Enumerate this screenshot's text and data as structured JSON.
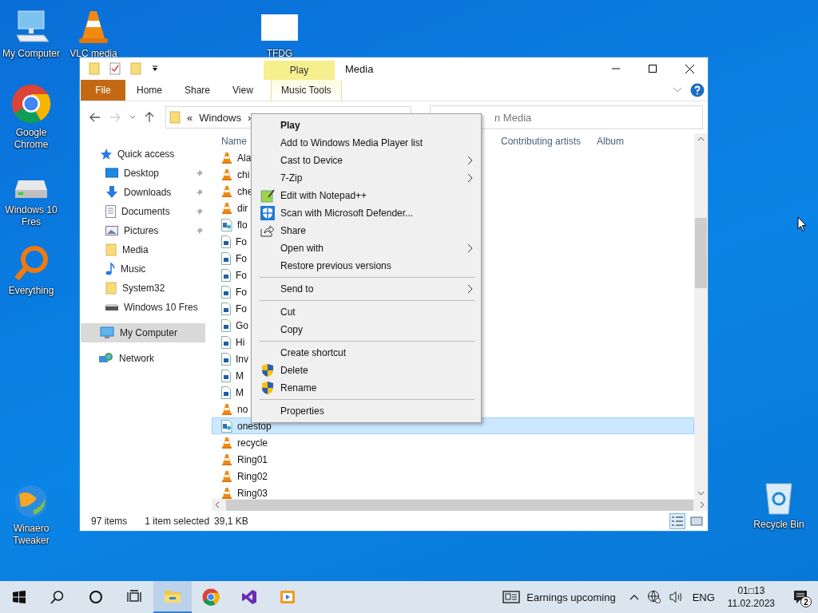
{
  "desktop_icons": [
    {
      "label": "My Computer",
      "kind": "computer"
    },
    {
      "label": "VLC media",
      "kind": "vlc"
    },
    {
      "label": "TFDG",
      "kind": "blank"
    },
    {
      "label": "Google Chrome",
      "kind": "chrome"
    },
    {
      "label": "Windows 10 Fres",
      "kind": "drive"
    },
    {
      "label": "Everything",
      "kind": "everything"
    },
    {
      "label": "Winaero Tweaker",
      "kind": "winaero"
    },
    {
      "label": "Recycle Bin",
      "kind": "recycle"
    }
  ],
  "explorer": {
    "title": "Media",
    "contextual_tab": "Play",
    "ribbon_tabs": [
      {
        "label": "File",
        "kind": "file",
        "selected": false
      },
      {
        "label": "Home",
        "kind": "tab",
        "selected": false
      },
      {
        "label": "Share",
        "kind": "tab",
        "selected": false
      },
      {
        "label": "View",
        "kind": "tab",
        "selected": false
      },
      {
        "label": "Music Tools",
        "kind": "contextual",
        "selected": false
      }
    ],
    "address": [
      "«",
      "Windows",
      "›"
    ],
    "search": {
      "placeholder": "n Media"
    },
    "nav": [
      {
        "label": "Quick access",
        "kind": "star",
        "selected": false,
        "children": [
          {
            "label": "Desktop",
            "kind": "desktop",
            "pinned": true,
            "selected": false
          },
          {
            "label": "Downloads",
            "kind": "downloads",
            "pinned": true,
            "selected": false
          },
          {
            "label": "Documents",
            "kind": "documents",
            "pinned": true,
            "selected": false
          },
          {
            "label": "Pictures",
            "kind": "pictures",
            "pinned": true,
            "selected": false
          },
          {
            "label": "Media",
            "kind": "folder",
            "pinned": false,
            "selected": false
          },
          {
            "label": "Music",
            "kind": "music",
            "pinned": false,
            "selected": false
          },
          {
            "label": "System32",
            "kind": "folder",
            "pinned": false,
            "selected": false
          },
          {
            "label": "Windows 10 Fres",
            "kind": "drive",
            "pinned": false,
            "selected": false
          }
        ]
      },
      {
        "label": "My Computer",
        "kind": "computer",
        "selected": true
      },
      {
        "label": "Network",
        "kind": "network",
        "selected": false
      }
    ],
    "columns": [
      "Name",
      "Contributing artists",
      "Album"
    ],
    "files": [
      {
        "name": "Ala",
        "kind": "vlc",
        "selected": false
      },
      {
        "name": "chi",
        "kind": "vlc",
        "selected": false
      },
      {
        "name": "che",
        "kind": "vlc",
        "selected": false
      },
      {
        "name": "dir",
        "kind": "vlc",
        "selected": false
      },
      {
        "name": "flo",
        "kind": "media",
        "selected": false
      },
      {
        "name": "Fo",
        "kind": "image",
        "selected": false
      },
      {
        "name": "Fo",
        "kind": "image",
        "selected": false
      },
      {
        "name": "Fo",
        "kind": "image",
        "selected": false
      },
      {
        "name": "Fo",
        "kind": "image",
        "selected": false
      },
      {
        "name": "Fo",
        "kind": "image",
        "selected": false
      },
      {
        "name": "Go",
        "kind": "image",
        "selected": false
      },
      {
        "name": "Hi",
        "kind": "image",
        "selected": false
      },
      {
        "name": "Inv",
        "kind": "image",
        "selected": false
      },
      {
        "name": "M",
        "kind": "image",
        "selected": false
      },
      {
        "name": "M",
        "kind": "image",
        "selected": false
      },
      {
        "name": "no",
        "kind": "vlc",
        "selected": false
      },
      {
        "name": "onestop",
        "kind": "media",
        "selected": true
      },
      {
        "name": "recycle",
        "kind": "vlc",
        "selected": false
      },
      {
        "name": "Ring01",
        "kind": "vlc",
        "selected": false
      },
      {
        "name": "Ring02",
        "kind": "vlc",
        "selected": false
      },
      {
        "name": "Ring03",
        "kind": "vlc",
        "selected": false
      }
    ],
    "status": {
      "count": "97 items",
      "selection": "1 item selected",
      "size": "39,1 KB"
    }
  },
  "context_menu": [
    {
      "label": "Play",
      "kind": "plain",
      "default": true,
      "submenu": false
    },
    {
      "label": "Add to Windows Media Player list",
      "kind": "plain",
      "default": false,
      "submenu": false
    },
    {
      "label": "Cast to Device",
      "kind": "plain",
      "default": false,
      "submenu": true
    },
    {
      "label": "7-Zip",
      "kind": "plain",
      "default": false,
      "submenu": true
    },
    {
      "label": "Edit with Notepad++",
      "kind": "notepad",
      "default": false,
      "submenu": false
    },
    {
      "label": "Scan with Microsoft Defender...",
      "kind": "defender",
      "default": false,
      "submenu": false
    },
    {
      "label": "Share",
      "kind": "share",
      "default": false,
      "submenu": false
    },
    {
      "label": "Open with",
      "kind": "plain",
      "default": false,
      "submenu": true
    },
    {
      "label": "Restore previous versions",
      "kind": "plain",
      "default": false,
      "submenu": false
    },
    {
      "kind": "separator"
    },
    {
      "label": "Send to",
      "kind": "plain",
      "default": false,
      "submenu": true
    },
    {
      "kind": "separator"
    },
    {
      "label": "Cut",
      "kind": "plain",
      "default": false,
      "submenu": false
    },
    {
      "label": "Copy",
      "kind": "plain",
      "default": false,
      "submenu": false
    },
    {
      "kind": "separator"
    },
    {
      "label": "Create shortcut",
      "kind": "plain",
      "default": false,
      "submenu": false
    },
    {
      "label": "Delete",
      "kind": "uac",
      "default": false,
      "submenu": false
    },
    {
      "label": "Rename",
      "kind": "uac",
      "default": false,
      "submenu": false
    },
    {
      "kind": "separator"
    },
    {
      "label": "Properties",
      "kind": "plain",
      "default": false,
      "submenu": false
    }
  ],
  "taskbar": {
    "apps": [
      {
        "kind": "start",
        "active": false
      },
      {
        "kind": "search",
        "active": false
      },
      {
        "kind": "cortana",
        "active": false
      },
      {
        "kind": "taskview",
        "active": false
      },
      {
        "kind": "explorer",
        "active": true
      },
      {
        "kind": "chrome",
        "active": false
      },
      {
        "kind": "vs",
        "active": false
      },
      {
        "kind": "media",
        "active": false
      }
    ],
    "news": "Earnings upcoming",
    "language": "ENG",
    "time": "01□13",
    "date": "11.02.2023",
    "notifications": "2"
  }
}
